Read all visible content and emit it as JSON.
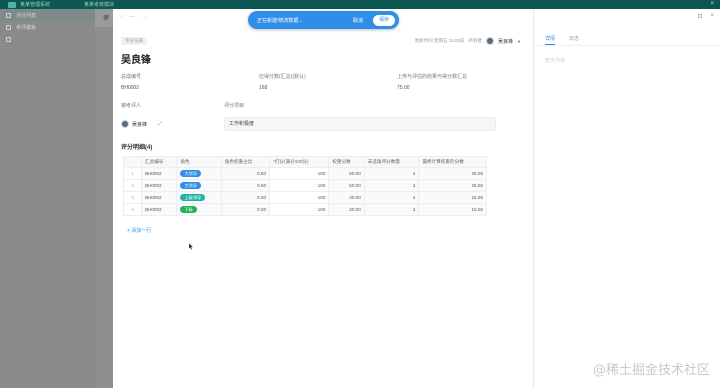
{
  "topbar": {
    "app_title": "某某管理系统",
    "tab_title": "某某考核模块",
    "close": "×"
  },
  "sidebar": {
    "items": [
      {
        "label": "评分列表"
      },
      {
        "label": "考评模板"
      },
      {
        "label": ""
      }
    ]
  },
  "subtab": {
    "label": "评"
  },
  "panel": {
    "nav_icons": [
      "‹",
      "—",
      "⋯"
    ],
    "chip": "评分记录",
    "meta": {
      "time_text": "更新时间 星期五 15:00前",
      "owner_label": "所有者",
      "owner_name": "吴良锋"
    },
    "title": "吴良锋",
    "fields": {
      "code_label": "总成编号",
      "code_value": "BH0002",
      "score_label": "应得分数(汇总)(默认)",
      "score_value": "168",
      "period_label": "上传与评估的结果与得分数汇总",
      "period_value": "75.00",
      "evaluator_label": "被考评人",
      "evaluator_name": "吴良锋",
      "assess_label": "评分项目",
      "assess_value": "工作积极度"
    },
    "section_title": "评分明细(4)",
    "table": {
      "headers": [
        "",
        "汇总编号",
        "角色",
        "角色权重占比",
        "*打分(满分100分)",
        "权重分数",
        "未选角评分数量",
        "最终计算权重的分数"
      ],
      "rows": [
        {
          "idx": "1",
          "code": "BH0002",
          "role": "大领导",
          "role_color": "#2f8fe8",
          "weight": "0.50",
          "score": "100",
          "weighted": "50.00",
          "unrated": "2",
          "final": "25.00"
        },
        {
          "idx": "2",
          "code": "BH0002",
          "role": "大领导",
          "role_color": "#2f8fe8",
          "weight": "0.50",
          "score": "100",
          "weighted": "50.00",
          "unrated": "2",
          "final": "25.00"
        },
        {
          "idx": "3",
          "code": "BH0002",
          "role": "上级领导",
          "role_color": "#1fb5a6",
          "weight": "0.30",
          "score": "100",
          "weighted": "30.00",
          "unrated": "2",
          "final": "15.00"
        },
        {
          "idx": "4",
          "code": "BH0002",
          "role": "下级",
          "role_color": "#25b05a",
          "weight": "0.20",
          "score": "100",
          "weighted": "20.00",
          "unrated": "2",
          "final": "10.00"
        }
      ]
    },
    "add_row": "+ 添加一行"
  },
  "rpanel": {
    "icons": [
      "⊡",
      "×"
    ],
    "tabs": [
      "详情",
      "日志"
    ],
    "placeholder": "暂无内容"
  },
  "savebar": {
    "message": "正在新建/修改数据...",
    "cancel": "取消",
    "save": "保存"
  },
  "watermark": "@稀土掘金技术社区",
  "colors": {
    "primary": "#2f8fe8",
    "topbar": "#0d5752"
  }
}
